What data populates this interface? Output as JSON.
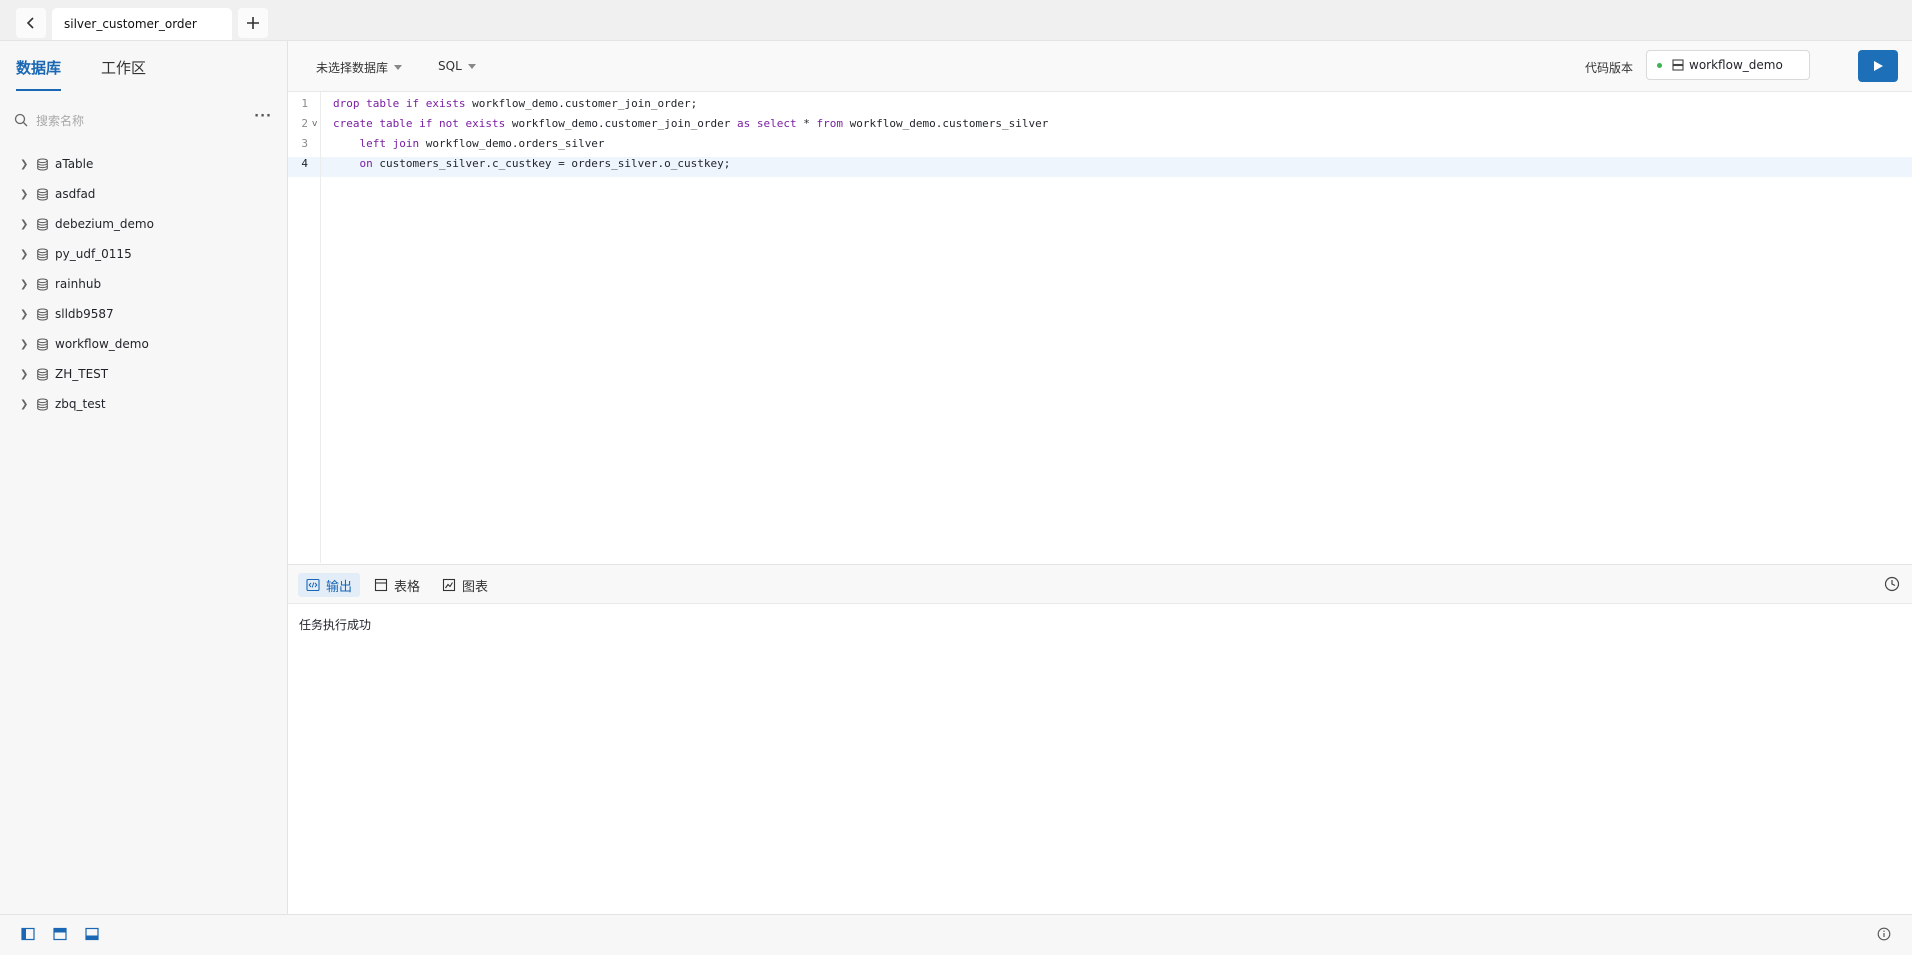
{
  "tabs": {
    "active_tab": "silver_customer_order"
  },
  "sidebar": {
    "tabs": [
      "数据库",
      "工作区"
    ],
    "search_placeholder": "搜索名称",
    "databases": [
      "aTable",
      "asdfad",
      "debezium_demo",
      "py_udf_0115",
      "rainhub",
      "slldb9587",
      "workflow_demo",
      "ZH_TEST",
      "zbq_test"
    ]
  },
  "toolbar": {
    "database_select": "未选择数据库",
    "language_select": "SQL",
    "version_label": "代码版本",
    "version_value": "workflow_demo"
  },
  "editor": {
    "line_numbers": [
      "1",
      "2",
      "3",
      "4"
    ],
    "current_line": 4,
    "lines": [
      [
        [
          "kw",
          "drop"
        ],
        [
          "t",
          " "
        ],
        [
          "kw",
          "table"
        ],
        [
          "t",
          " "
        ],
        [
          "kw",
          "if"
        ],
        [
          "t",
          " "
        ],
        [
          "kw",
          "exists"
        ],
        [
          "t",
          " workflow_demo.customer_join_order;"
        ]
      ],
      [
        [
          "kw",
          "create"
        ],
        [
          "t",
          " "
        ],
        [
          "kw",
          "table"
        ],
        [
          "t",
          " "
        ],
        [
          "kw",
          "if"
        ],
        [
          "t",
          " "
        ],
        [
          "kw",
          "not"
        ],
        [
          "t",
          " "
        ],
        [
          "kw",
          "exists"
        ],
        [
          "t",
          " workflow_demo.customer_join_order "
        ],
        [
          "kw",
          "as"
        ],
        [
          "t",
          " "
        ],
        [
          "kw",
          "select"
        ],
        [
          "t",
          " * "
        ],
        [
          "kw",
          "from"
        ],
        [
          "t",
          " workflow_demo.customers_silver"
        ]
      ],
      [
        [
          "t",
          "    "
        ],
        [
          "kw",
          "left"
        ],
        [
          "t",
          " "
        ],
        [
          "kw",
          "join"
        ],
        [
          "t",
          " workflow_demo.orders_silver"
        ]
      ],
      [
        [
          "t",
          "    "
        ],
        [
          "kw",
          "on"
        ],
        [
          "t",
          " customers_silver.c_custkey = orders_silver.o_custkey;"
        ]
      ]
    ]
  },
  "results": {
    "tabs": [
      "输出",
      "表格",
      "图表"
    ],
    "active": "输出",
    "output_text": "任务执行成功"
  },
  "colors": {
    "accent": "#1a67b3",
    "run_button": "#1d6fb8",
    "keyword": "#7a1fa2",
    "status_dot": "#3cb550"
  }
}
